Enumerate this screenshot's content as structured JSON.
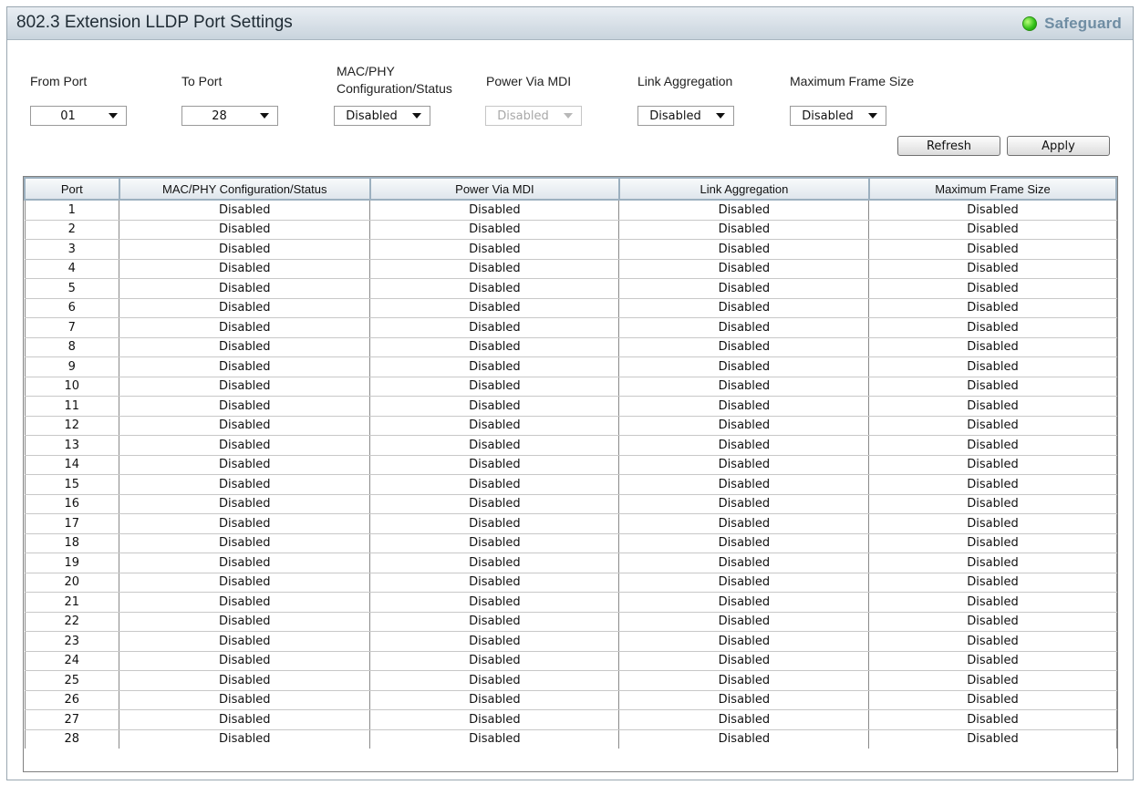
{
  "title": "802.3 Extension LLDP Port Settings",
  "safeguard": {
    "label": "Safeguard",
    "color": "#2fbf17"
  },
  "form": {
    "from_port": {
      "label": "From Port",
      "value": "01"
    },
    "to_port": {
      "label": "To Port",
      "value": "28"
    },
    "mac_phy": {
      "label_line1": "MAC/PHY",
      "label_line2": "Configuration/Status",
      "value": "Disabled"
    },
    "power_via_mdi": {
      "label": "Power Via MDI",
      "value": "Disabled",
      "disabled": true
    },
    "link_aggregation": {
      "label": "Link Aggregation",
      "value": "Disabled"
    },
    "max_frame_size": {
      "label": "Maximum Frame Size",
      "value": "Disabled"
    }
  },
  "buttons": {
    "refresh": "Refresh",
    "apply": "Apply"
  },
  "table": {
    "columns": [
      "Port",
      "MAC/PHY Configuration/Status",
      "Power Via MDI",
      "Link Aggregation",
      "Maximum Frame Size"
    ],
    "rows": [
      [
        "1",
        "Disabled",
        "Disabled",
        "Disabled",
        "Disabled"
      ],
      [
        "2",
        "Disabled",
        "Disabled",
        "Disabled",
        "Disabled"
      ],
      [
        "3",
        "Disabled",
        "Disabled",
        "Disabled",
        "Disabled"
      ],
      [
        "4",
        "Disabled",
        "Disabled",
        "Disabled",
        "Disabled"
      ],
      [
        "5",
        "Disabled",
        "Disabled",
        "Disabled",
        "Disabled"
      ],
      [
        "6",
        "Disabled",
        "Disabled",
        "Disabled",
        "Disabled"
      ],
      [
        "7",
        "Disabled",
        "Disabled",
        "Disabled",
        "Disabled"
      ],
      [
        "8",
        "Disabled",
        "Disabled",
        "Disabled",
        "Disabled"
      ],
      [
        "9",
        "Disabled",
        "Disabled",
        "Disabled",
        "Disabled"
      ],
      [
        "10",
        "Disabled",
        "Disabled",
        "Disabled",
        "Disabled"
      ],
      [
        "11",
        "Disabled",
        "Disabled",
        "Disabled",
        "Disabled"
      ],
      [
        "12",
        "Disabled",
        "Disabled",
        "Disabled",
        "Disabled"
      ],
      [
        "13",
        "Disabled",
        "Disabled",
        "Disabled",
        "Disabled"
      ],
      [
        "14",
        "Disabled",
        "Disabled",
        "Disabled",
        "Disabled"
      ],
      [
        "15",
        "Disabled",
        "Disabled",
        "Disabled",
        "Disabled"
      ],
      [
        "16",
        "Disabled",
        "Disabled",
        "Disabled",
        "Disabled"
      ],
      [
        "17",
        "Disabled",
        "Disabled",
        "Disabled",
        "Disabled"
      ],
      [
        "18",
        "Disabled",
        "Disabled",
        "Disabled",
        "Disabled"
      ],
      [
        "19",
        "Disabled",
        "Disabled",
        "Disabled",
        "Disabled"
      ],
      [
        "20",
        "Disabled",
        "Disabled",
        "Disabled",
        "Disabled"
      ],
      [
        "21",
        "Disabled",
        "Disabled",
        "Disabled",
        "Disabled"
      ],
      [
        "22",
        "Disabled",
        "Disabled",
        "Disabled",
        "Disabled"
      ],
      [
        "23",
        "Disabled",
        "Disabled",
        "Disabled",
        "Disabled"
      ],
      [
        "24",
        "Disabled",
        "Disabled",
        "Disabled",
        "Disabled"
      ],
      [
        "25",
        "Disabled",
        "Disabled",
        "Disabled",
        "Disabled"
      ],
      [
        "26",
        "Disabled",
        "Disabled",
        "Disabled",
        "Disabled"
      ],
      [
        "27",
        "Disabled",
        "Disabled",
        "Disabled",
        "Disabled"
      ],
      [
        "28",
        "Disabled",
        "Disabled",
        "Disabled",
        "Disabled"
      ]
    ]
  }
}
